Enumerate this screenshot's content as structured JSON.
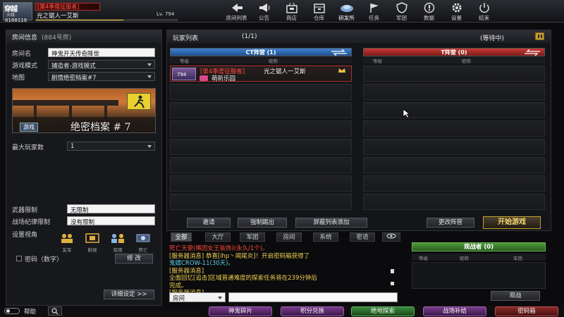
{
  "player": {
    "brand_logo": "穿越",
    "brand_sub": "火线",
    "id": "8188116",
    "title_tag": "[第4季度征服者]",
    "name": "光之锯人一艾斯",
    "level": "Lv. 794",
    "exp_fraction": 0.62
  },
  "nav": [
    {
      "icon": "back-arrow",
      "label": "房间列表"
    },
    {
      "icon": "megaphone",
      "label": "公告"
    },
    {
      "icon": "shop",
      "label": "商店"
    },
    {
      "icon": "warehouse",
      "label": "仓库"
    },
    {
      "icon": "research",
      "label": "研发所"
    },
    {
      "icon": "flag",
      "label": "任务"
    },
    {
      "icon": "shield",
      "label": "军团"
    },
    {
      "icon": "info",
      "label": "数据"
    },
    {
      "icon": "gear",
      "label": "设置"
    },
    {
      "icon": "power",
      "label": "结束"
    }
  ],
  "room_info": {
    "header": "房间信息",
    "room_no": "(884号房)",
    "name_label": "房间名",
    "name_value": "神鬼开天传奇降世",
    "mode_label": "游戏模式",
    "mode_value": "捕造者-游戏模式",
    "map_label": "地图",
    "map_value": "剧情绝密档案#7",
    "map_mode_tag": "游戏",
    "map_title": "绝密档案 # 7",
    "max_players_label": "最大玩家数",
    "max_players_value": "1",
    "weapon_label": "武器限制",
    "weapon_value": "无限制",
    "discipline_label": "战场纪律限制",
    "discipline_value": "没有限制",
    "view_label": "设置视角",
    "view_options": [
      "友军",
      "俯视",
      "旁观",
      "死亡"
    ],
    "password_label": "密码（数字）",
    "edit_button": "修 改",
    "detail_button": "详细设定 >>"
  },
  "player_list": {
    "header": "玩家列表",
    "count": "(1/1)",
    "status": "(等待中)",
    "ct_label": "CT阵营 (1)",
    "t_label": "T阵营 (0)",
    "col_grade": "等级",
    "col_name": "昵称",
    "ct_players": [
      {
        "title": "[第4季度征服者]",
        "name": "光之锯人一艾斯",
        "clan": "萌新乐园",
        "level": "794"
      }
    ],
    "slot_count": 8
  },
  "actions": {
    "invite": "邀请",
    "kick": "强制踢出",
    "block": "屏蔽列表添加",
    "change_camp": "更改阵营",
    "start_game": "开始游戏"
  },
  "chat": {
    "tabs": [
      "全部",
      "大厅",
      "军团",
      "房间",
      "系统",
      "密语"
    ],
    "lines": [
      {
        "color": "red",
        "text": "死亡天使(稀因女王装饰)(永久/1个)。"
      },
      {
        "color": "yellow",
        "text": "[服务器消息] 恭喜[ihp丶闻尾炎]！开启密码箱获得了"
      },
      {
        "color": "cyan",
        "text": "鬼婿CROW-11(30天)。"
      },
      {
        "color": "yellow",
        "text": "[服务器消息]"
      },
      {
        "color": "yellow",
        "text": "全面回忆[追击]区域普通难度的探索任务将在239分钟后"
      },
      {
        "color": "yellow",
        "text": "完成。"
      },
      {
        "color": "yellow",
        "text": "[服务器消息]"
      }
    ],
    "channel": "房间",
    "input_value": ""
  },
  "spectators": {
    "header": "观战者 (0)",
    "col_grade": "等级",
    "col_name": "昵称",
    "col_clan": "军团",
    "watch_button": "观战"
  },
  "bottom": {
    "help": "帮助",
    "buttons": [
      "神鬼碎片",
      "积分兑换",
      "绝地探索",
      "战场补给",
      "密码箱"
    ]
  },
  "colors": {
    "ct_blue": "#2a6ab8",
    "t_red": "#b02828",
    "start_gold": "#e8c040",
    "spectator_green": "#3a7a2a"
  }
}
